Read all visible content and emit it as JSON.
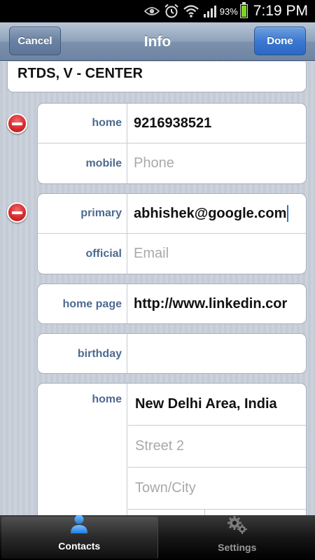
{
  "status_bar": {
    "icons": [
      "eye-icon",
      "alarm-icon",
      "wifi-icon",
      "signal-icon"
    ],
    "battery_percent": "93%",
    "time": "7:19 PM"
  },
  "navbar": {
    "title": "Info",
    "cancel_label": "Cancel",
    "done_label": "Done"
  },
  "company": "RTDS, V - CENTER",
  "phones": [
    {
      "label": "home",
      "value": "9216938521"
    },
    {
      "label": "mobile",
      "placeholder": "Phone"
    }
  ],
  "emails": [
    {
      "label": "primary",
      "value": "abhishek@google.com"
    },
    {
      "label": "official",
      "placeholder": "Email"
    }
  ],
  "homepage": {
    "label": "home page",
    "value": "http://www.linkedin.cor"
  },
  "birthday": {
    "label": "birthday",
    "value": ""
  },
  "address": {
    "label": "home",
    "line1": "New Delhi Area, India",
    "street2_placeholder": "Street 2",
    "city_placeholder": "Town/City"
  },
  "tabs": [
    {
      "label": "Contacts",
      "icon": "person-icon",
      "active": true
    },
    {
      "label": "Settings",
      "icon": "gears-icon",
      "active": false
    }
  ],
  "colors": {
    "accent": "#3c79d0",
    "label": "#4d6a90",
    "delete": "#d3262b"
  }
}
